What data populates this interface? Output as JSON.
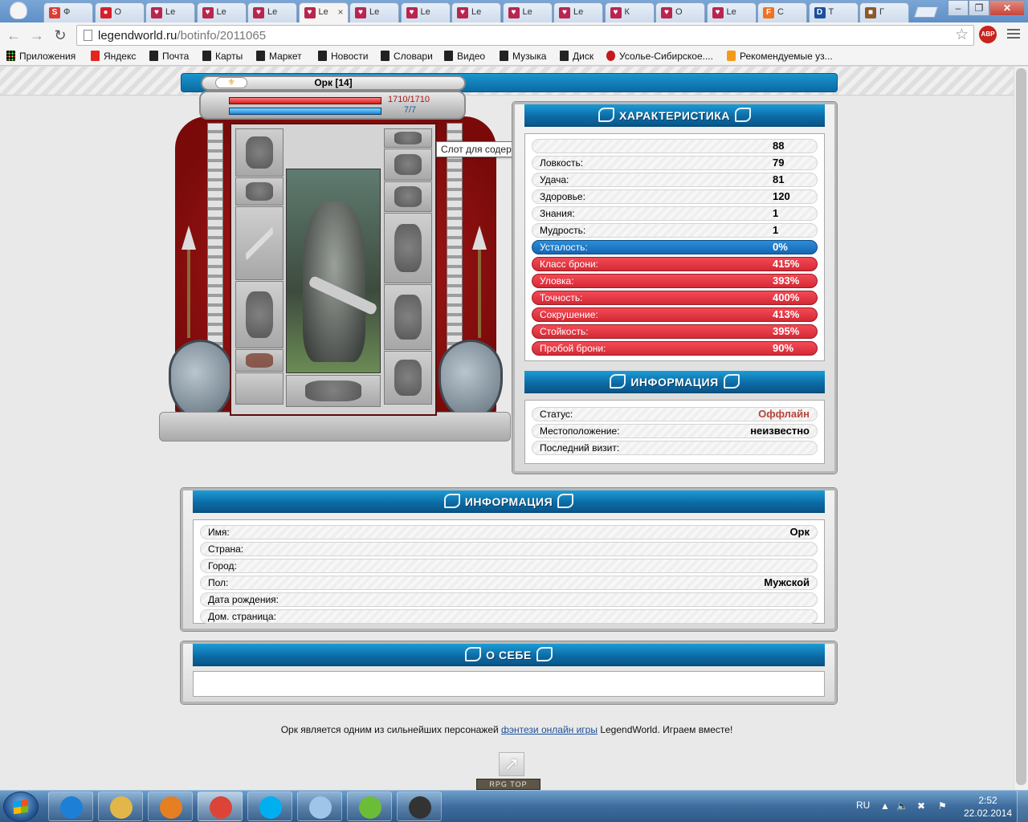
{
  "browser": {
    "tabs": [
      {
        "title": "Ф",
        "color": "#e03c31",
        "icon": "S"
      },
      {
        "title": "О",
        "color": "#d81e2b",
        "icon": "●"
      },
      {
        "title": "Le",
        "color": "#b8264f",
        "icon": "♥"
      },
      {
        "title": "Le",
        "color": "#b8264f",
        "icon": "♥"
      },
      {
        "title": "Le",
        "color": "#b8264f",
        "icon": "♥"
      },
      {
        "title": "Le",
        "color": "#b8264f",
        "icon": "♥",
        "active": true
      },
      {
        "title": "Le",
        "color": "#b8264f",
        "icon": "♥"
      },
      {
        "title": "Le",
        "color": "#b8264f",
        "icon": "♥"
      },
      {
        "title": "Le",
        "color": "#b8264f",
        "icon": "♥"
      },
      {
        "title": "Le",
        "color": "#b8264f",
        "icon": "♥"
      },
      {
        "title": "Le",
        "color": "#b8264f",
        "icon": "♥"
      },
      {
        "title": "К",
        "color": "#b8264f",
        "icon": "♥"
      },
      {
        "title": "О",
        "color": "#b8264f",
        "icon": "♥"
      },
      {
        "title": "Le",
        "color": "#b8264f",
        "icon": "♥"
      },
      {
        "title": "С",
        "color": "#f37021",
        "icon": "F"
      },
      {
        "title": "Т",
        "color": "#1b4f9b",
        "icon": "D"
      },
      {
        "title": "Г",
        "color": "#8a5a2b",
        "icon": "■"
      }
    ],
    "url_domain": "legendworld.ru",
    "url_path": "/botinfo/2011065",
    "abp_label": "ABP",
    "bookmarks": [
      {
        "label": "Приложения",
        "icon": "apps"
      },
      {
        "label": "Яндекс",
        "icon": "ya"
      },
      {
        "label": "Почта",
        "icon": "page"
      },
      {
        "label": "Карты",
        "icon": "page"
      },
      {
        "label": "Маркет",
        "icon": "page"
      },
      {
        "label": "Новости",
        "icon": "page"
      },
      {
        "label": "Словари",
        "icon": "page"
      },
      {
        "label": "Видео",
        "icon": "page"
      },
      {
        "label": "Музыка",
        "icon": "page"
      },
      {
        "label": "Диск",
        "icon": "page"
      },
      {
        "label": "Усолье-Сибирское....",
        "icon": "red"
      },
      {
        "label": "Рекомендуемые уз...",
        "icon": "orange"
      }
    ]
  },
  "character": {
    "name": "Орк [14]",
    "alignment_icon": "winged-emblem-icon",
    "hp_text": "1710/1710",
    "hp_fraction": 1.0,
    "mp_text": "7/7",
    "mp_fraction": 1.0,
    "tooltip": "Слот для содержимого пояса"
  },
  "stats_panel": {
    "title": "ХАРАКТЕРИСТИКА",
    "rows": [
      {
        "label": "",
        "value": "88",
        "style": "plain"
      },
      {
        "label": "Ловкость:",
        "value": "79",
        "style": "plain"
      },
      {
        "label": "Удача:",
        "value": "81",
        "style": "plain"
      },
      {
        "label": "Здоровье:",
        "value": "120",
        "style": "plain"
      },
      {
        "label": "Знания:",
        "value": "1",
        "style": "plain"
      },
      {
        "label": "Мудрость:",
        "value": "1",
        "style": "plain"
      },
      {
        "label": "Усталость:",
        "value": "0%",
        "style": "blue"
      },
      {
        "label": "Класс брони:",
        "value": "415%",
        "style": "red"
      },
      {
        "label": "Уловка:",
        "value": "393%",
        "style": "red"
      },
      {
        "label": "Точность:",
        "value": "400%",
        "style": "red"
      },
      {
        "label": "Сокрушение:",
        "value": "413%",
        "style": "red"
      },
      {
        "label": "Стойкость:",
        "value": "395%",
        "style": "red"
      },
      {
        "label": "Пробой брони:",
        "value": "90%",
        "style": "red"
      }
    ]
  },
  "status_panel": {
    "title": "ИНФОРМАЦИЯ",
    "rows": [
      {
        "label": "Статус:",
        "value": "Оффлайн",
        "color": "#b5463d"
      },
      {
        "label": "Местоположение:",
        "value": "неизвестно",
        "color": "#000000"
      },
      {
        "label": "Последний визит:",
        "value": "",
        "color": "#000000"
      }
    ]
  },
  "profile_panel": {
    "title": "ИНФОРМАЦИЯ",
    "rows": [
      {
        "label": "Имя:",
        "value": "Орк"
      },
      {
        "label": "Страна:",
        "value": ""
      },
      {
        "label": "Город:",
        "value": ""
      },
      {
        "label": "Пол:",
        "value": "Мужской"
      },
      {
        "label": "Дата рождения:",
        "value": ""
      },
      {
        "label": "Дом. страница:",
        "value": ""
      }
    ]
  },
  "about_panel": {
    "title": "О СЕБЕ",
    "text": ""
  },
  "footer": {
    "before": "Орк является одним из сильнейших персонажей ",
    "link": "фэнтези онлайн игры",
    "after": " LegendWorld. Играем вместе!",
    "rpg_badge": "RPG TOP"
  },
  "taskbar": {
    "apps": [
      {
        "name": "internet-explorer-icon",
        "color": "#1e7fd6"
      },
      {
        "name": "explorer-folder-icon",
        "color": "#e3b64a"
      },
      {
        "name": "media-player-icon",
        "color": "#e67e22"
      },
      {
        "name": "chrome-icon",
        "color": "#db4437",
        "active": true
      },
      {
        "name": "skype-icon",
        "color": "#00aff0"
      },
      {
        "name": "notepad-icon",
        "color": "#9fc5e8"
      },
      {
        "name": "utorrent-icon",
        "color": "#6bbd38"
      },
      {
        "name": "video-editor-icon",
        "color": "#333333"
      }
    ],
    "lang": "RU",
    "time": "2:52",
    "date": "22.02.2014"
  },
  "colors": {
    "accent_blue": "#0c6aa4",
    "stat_red": "#e23642",
    "stat_blue": "#1f78c8",
    "offline": "#b5463d"
  }
}
